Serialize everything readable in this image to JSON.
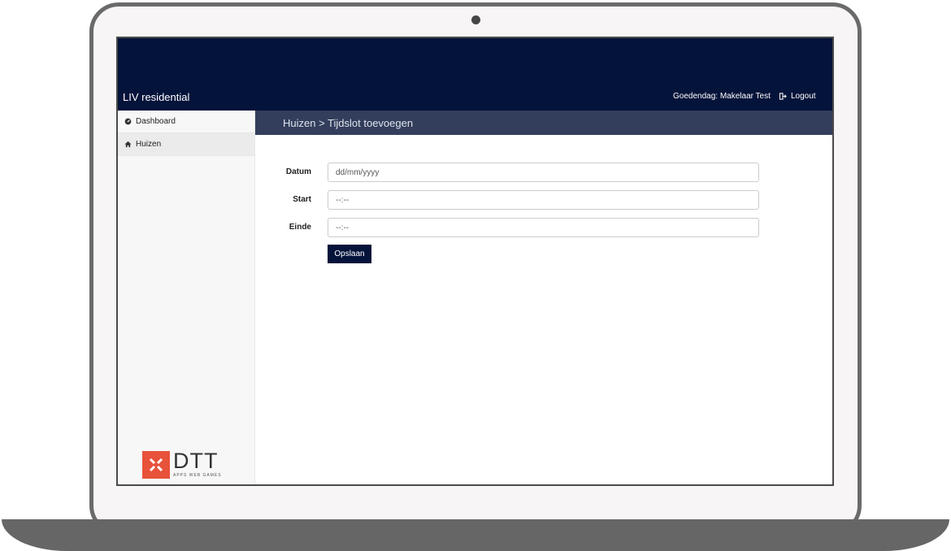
{
  "header": {
    "brand": "LIV residential",
    "greeting": "Goedendag: Makelaar Test",
    "logout_label": "Logout"
  },
  "sidebar": {
    "items": [
      {
        "label": "Dashboard",
        "icon": "dashboard-icon"
      },
      {
        "label": "Huizen",
        "icon": "home-icon"
      }
    ],
    "logo": {
      "main": "DTT",
      "sub": "APPS WEB GAMES",
      "color": "#e8513a"
    }
  },
  "main": {
    "breadcrumb": "Huizen > Tijdslot toevoegen",
    "form": {
      "datum": {
        "label": "Datum",
        "placeholder": "dd/mm/yyyy"
      },
      "start": {
        "label": "Start",
        "placeholder": "--:--"
      },
      "einde": {
        "label": "Einde",
        "placeholder": "--:--"
      },
      "save_label": "Opslaan"
    }
  },
  "colors": {
    "navy": "#04133a",
    "breadcrumb_bar": "#333e5c",
    "accent": "#e8513a"
  }
}
